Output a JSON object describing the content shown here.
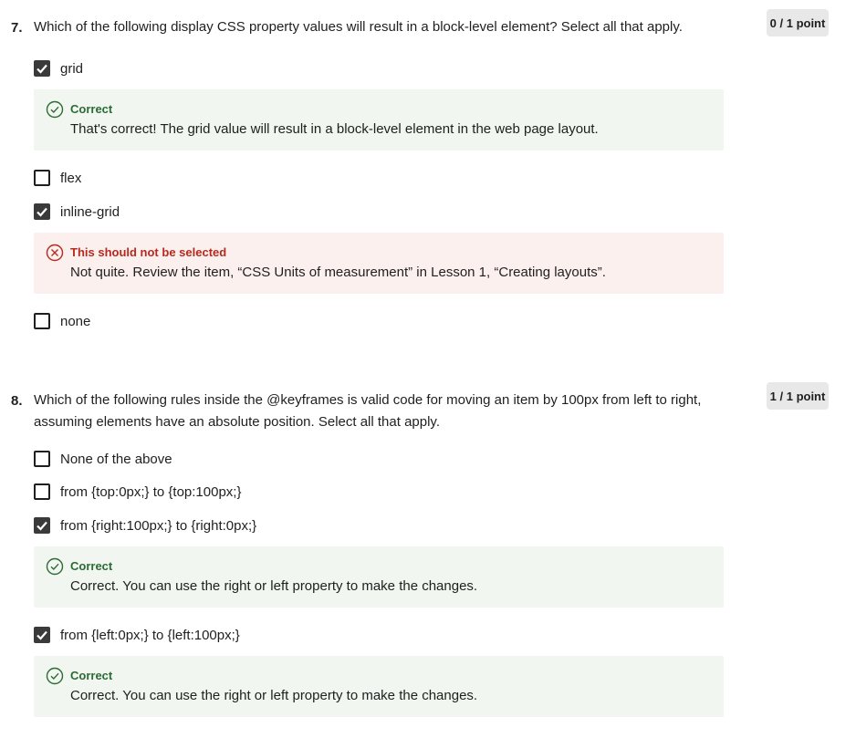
{
  "colors": {
    "correct_bg": "#f1f6f0",
    "correct_text": "#2c6b35",
    "incorrect_bg": "#fcf0ef",
    "incorrect_text": "#b52a1d",
    "badge_bg": "#e8e8e8",
    "checkbox_checked": "#3a3a3a"
  },
  "questions": [
    {
      "number": "7.",
      "text": "Which of the following display CSS property values will result in a block-level element? Select all that apply.",
      "points": "0 / 1 point",
      "options": [
        {
          "label": "grid",
          "checked": true,
          "feedback": {
            "type": "correct",
            "title": "Correct",
            "text": "That's correct! The grid value will result in a block-level element in the web page layout.",
            "icon": "check-circle-icon"
          }
        },
        {
          "label": "flex",
          "checked": false
        },
        {
          "label": "inline-grid",
          "checked": true,
          "feedback": {
            "type": "incorrect",
            "title": "This should not be selected",
            "text": "Not quite. Review the item, “CSS Units of measurement” in Lesson 1, “Creating layouts”.",
            "icon": "x-circle-icon"
          }
        },
        {
          "label": "none",
          "checked": false
        }
      ]
    },
    {
      "number": "8.",
      "text": "Which of the following rules inside the @keyframes is valid code for moving an item by 100px from left to right, assuming elements have an absolute position. Select all that apply.",
      "points": "1 / 1 point",
      "options": [
        {
          "label": "None of the above",
          "checked": false
        },
        {
          "label": "from {top:0px;} to {top:100px;}",
          "checked": false
        },
        {
          "label": "from {right:100px;} to {right:0px;}",
          "checked": true,
          "feedback": {
            "type": "correct",
            "title": "Correct",
            "text": "Correct. You can use the right or left property to make the changes.",
            "icon": "check-circle-icon"
          }
        },
        {
          "label": "from {left:0px;} to {left:100px;}",
          "checked": true,
          "feedback": {
            "type": "correct",
            "title": "Correct",
            "text": "Correct. You can use the right or left property to make the changes.",
            "icon": "check-circle-icon"
          }
        }
      ]
    }
  ]
}
